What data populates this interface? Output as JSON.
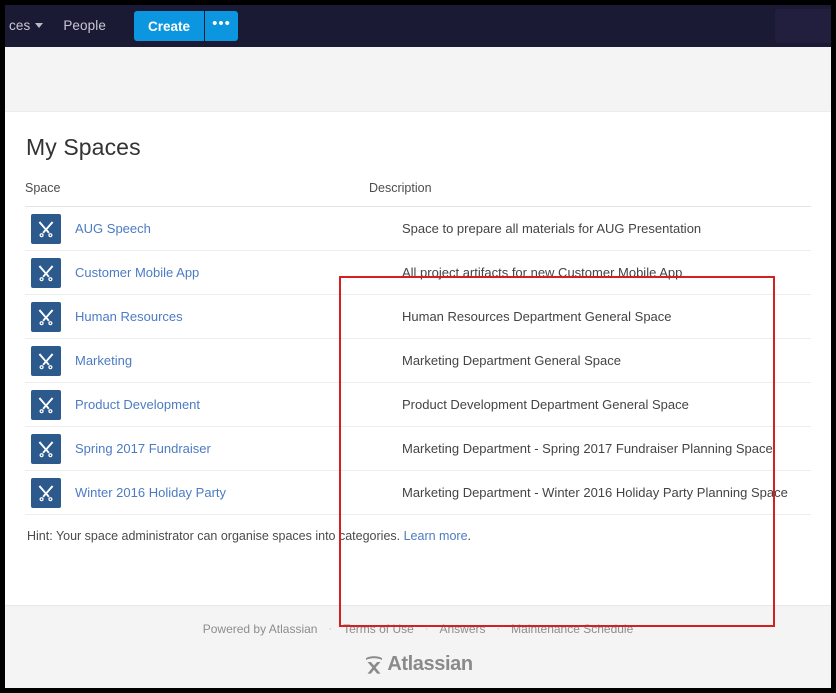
{
  "topnav": {
    "spaces_label": "ces",
    "spaces_icon": "chevron-down-icon",
    "people_label": "People",
    "create_label": "Create",
    "create_more_label": "•••"
  },
  "page": {
    "title": "My Spaces"
  },
  "table": {
    "headers": {
      "space": "Space",
      "description": "Description"
    },
    "rows": [
      {
        "icon": "space-avatar-icon",
        "name": "AUG Speech",
        "description": "Space to prepare all materials for AUG Presentation"
      },
      {
        "icon": "space-avatar-icon",
        "name": "Customer Mobile App",
        "description": "All project artifacts for new Customer Mobile App"
      },
      {
        "icon": "space-avatar-icon",
        "name": "Human Resources",
        "description": "Human Resources Department General Space"
      },
      {
        "icon": "space-avatar-icon",
        "name": "Marketing",
        "description": "Marketing Department General Space"
      },
      {
        "icon": "space-avatar-icon",
        "name": "Product Development",
        "description": "Product Development Department General Space"
      },
      {
        "icon": "space-avatar-icon",
        "name": "Spring 2017 Fundraiser",
        "description": "Marketing Department - Spring 2017 Fundraiser Planning Space"
      },
      {
        "icon": "space-avatar-icon",
        "name": "Winter 2016 Holiday Party",
        "description": "Marketing Department - Winter 2016 Holiday Party Planning Space"
      }
    ]
  },
  "hint": {
    "text": "Hint: Your space administrator can organise spaces into categories. ",
    "link_label": "Learn more",
    "trailing": "."
  },
  "footer": {
    "links": [
      "Powered by Atlassian",
      "Terms of Use",
      "Answers",
      "Maintenance Schedule"
    ],
    "separator": "·",
    "brand": "Atlassian"
  },
  "annotation": {
    "color": "#d32020",
    "target": "description-column"
  },
  "colors": {
    "nav_background": "#1b1a35",
    "create_button": "#0c96e0",
    "link": "#4c7bc4",
    "space_icon": "#2c5a8d",
    "annotation": "#d32020"
  }
}
